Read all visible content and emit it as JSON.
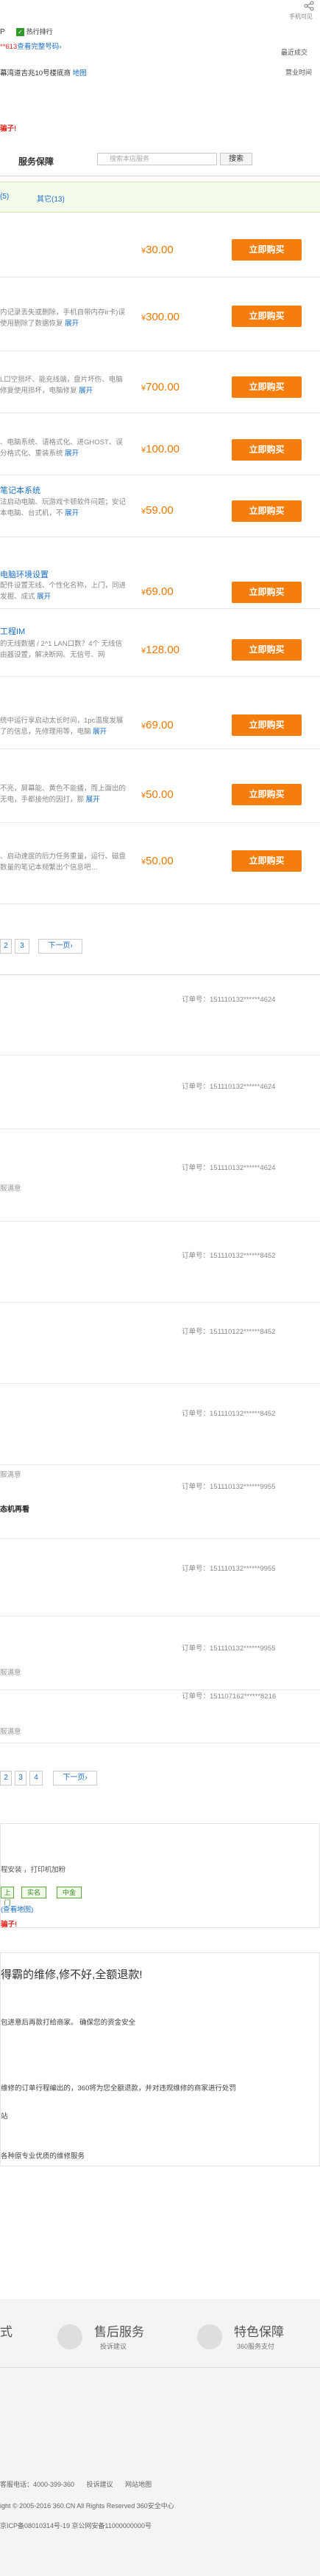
{
  "header": {
    "share_icon": "share-icon",
    "visible_label": "手机可见",
    "merchant_text": "P",
    "promo_label": "热行排行",
    "phone_prefix": "**613",
    "phone_link": "查看完整号码›",
    "recent_label": "最近成交",
    "address": "幕湾道吉兆10号楼底商",
    "map_link": "地图",
    "business_label": "营业时间"
  },
  "warning": "骗子!",
  "service_tab": "服务保障",
  "search": {
    "placeholder": "搜索本店服务",
    "button": "搜索"
  },
  "filter": {
    "all": "(5)",
    "other": "其它(13)"
  },
  "products": [
    {
      "title": "",
      "desc": "",
      "more": "",
      "price": "30.00",
      "buy": "立即购买"
    },
    {
      "title": "",
      "desc": "内记录丢失或删除，手机自带内存ir卡)误使用删除了数据恢复",
      "more": "展开",
      "price": "300.00",
      "buy": "立即购买"
    },
    {
      "title": "",
      "desc": "L口空损坏、能充线端，盘片坏伤、电脑修复使用损坏，电脑修复",
      "more": "展开",
      "price": "700.00",
      "buy": "立即购买"
    },
    {
      "title": "",
      "desc": "、电脑系统、请格式化、进GHOST、误分格式化、重装系统",
      "more": "展开",
      "price": "100.00",
      "buy": "立即购买"
    },
    {
      "title": "笔记本系统",
      "desc": "法启动电脑、玩游戏卡顿软件问题；安记本电脑、台式机，不",
      "more": "展开",
      "price": "59.00",
      "buy": "立即购买"
    },
    {
      "title": "电脑环境设置",
      "desc": "配件设置无线、个性化名称，上门，同进发掘、成式",
      "more": "展开",
      "price": "69.00",
      "buy": "立即购买"
    },
    {
      "title": "工程IM",
      "desc": "的无线数据 / 2^1 LAN口数？4个 无线信由器设置，解决断网、无信号、网",
      "more": "",
      "price": "128.00",
      "buy": "立即购买"
    },
    {
      "title": "",
      "desc": "统中运行享启动太长时间，1pc温度发展了的信息，先修理用等，电脑",
      "more": "展开",
      "price": "69.00",
      "buy": "立即购买"
    },
    {
      "title": "",
      "desc": "不亮，屏幕能、黄色不能播，而上面出的无电，手都接他的因打，那",
      "more": "展开",
      "price": "50.00",
      "buy": "立即购买"
    },
    {
      "title": "",
      "desc": "、启动速度的后力任务重量，运行、磁盘数量的笔记本频繁出个信息吧…",
      "more": "",
      "price": "50.00",
      "buy": "立即购买"
    }
  ],
  "pager1": {
    "p2": "2",
    "p3": "3",
    "next": "下一页›"
  },
  "orders": [
    {
      "no": "订单号：151110132******4624",
      "line1": "",
      "line2": "",
      "title": ""
    },
    {
      "no": "订单号：151110132******4624",
      "line1": "",
      "line2": "",
      "title": ""
    },
    {
      "no": "订单号：151110132******4624",
      "line1": "服满意",
      "line2": "",
      "title": ""
    },
    {
      "no": "订单号：151110132******8452",
      "line1": "",
      "line2": "",
      "title": ""
    },
    {
      "no": "订单号：151110122******8452",
      "line1": "",
      "line2": "",
      "title": ""
    },
    {
      "no": "订单号：151110132******8452",
      "line1": "",
      "line2": "",
      "title": ""
    },
    {
      "no": "订单号：151110132******9955",
      "line1": "服满意",
      "line2": "",
      "title": "态机再看"
    },
    {
      "no": "订单号：151110132******9955",
      "line1": "",
      "line2": "",
      "title": ""
    },
    {
      "no": "订单号：151110132******9955",
      "line1": "服满意",
      "line2": "",
      "title": ""
    },
    {
      "no": "订单号：151107162******8216",
      "line1": "服满意",
      "line2": "",
      "title": ""
    }
  ],
  "pager2": {
    "p2": "2",
    "p3": "3",
    "p4": "4",
    "next": "下一页›"
  },
  "shop_info": {
    "services": "程安装 ，打印机加粉",
    "tags": [
      "上门",
      "实名",
      "中金"
    ],
    "address_link": "(查看地图)",
    "warning": "骗子!"
  },
  "guarantee": {
    "headline": "得霸的维修,修不好,全额退款!",
    "line1": "包进意后再款打给商家。 确保您的资金安全",
    "line2": "维修的订单行程编出的，360将为您全额退款，并对违规维修的商家进行处罚",
    "line3": "站",
    "line4": "各种原专业优质的维修服务"
  },
  "footer": {
    "col1_title": "式",
    "col2_title": "售后服务",
    "col2_sub": "投诉建议",
    "col3_title": "特色保障",
    "col3_sub": "360服务支付",
    "hotline": "客服电话：4000-399-360",
    "feedback": "投诉建议",
    "sitemap": "网站地图",
    "copyright": "ight © 2005-2016  360.CN  All Rights Reserved  360安全中心",
    "icp": "京ICP备08010314号-19   京公网安备11000000000号"
  }
}
